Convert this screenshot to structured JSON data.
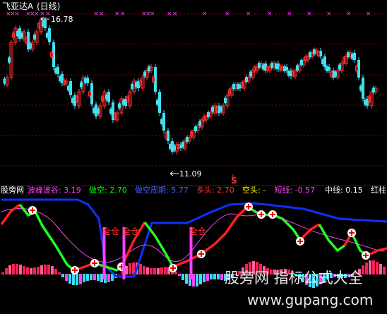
{
  "header": {
    "title": "飞亚达A",
    "period": "(日线)"
  },
  "annotations": {
    "high": "16.78",
    "low": "11.09",
    "s_mark": "S",
    "signal_label": "全仓"
  },
  "indicator_bar": {
    "name": "股旁网",
    "items": [
      {
        "label": "波峰波谷:",
        "value": "3.19",
        "color": "#ff40ff"
      },
      {
        "label": "做空:",
        "value": "2.70",
        "color": "#00ff00"
      },
      {
        "label": "做空周期:",
        "value": "5.77",
        "color": "#4060ff"
      },
      {
        "label": "多头:",
        "value": "2.70",
        "color": "#ff3030"
      },
      {
        "label": "空头:",
        "value": "-",
        "color": "#ffff00"
      },
      {
        "label": "短线:",
        "value": "-0.57",
        "color": "#ff40ff"
      },
      {
        "label": "中线:",
        "value": "0.15",
        "color": "#ffffff"
      },
      {
        "label": "红柱:",
        "value": "-",
        "color": "#ffffff"
      }
    ]
  },
  "watermark": {
    "line1": "股旁网 指标公式大全",
    "line2": "www.gupang.com"
  },
  "colors": {
    "up": "#ff3030",
    "down": "#40e0f0",
    "grid": "#800000",
    "magenta": "#ff40ff",
    "blue": "#1030ff",
    "green": "#20ff20",
    "red": "#ff2020"
  }
}
